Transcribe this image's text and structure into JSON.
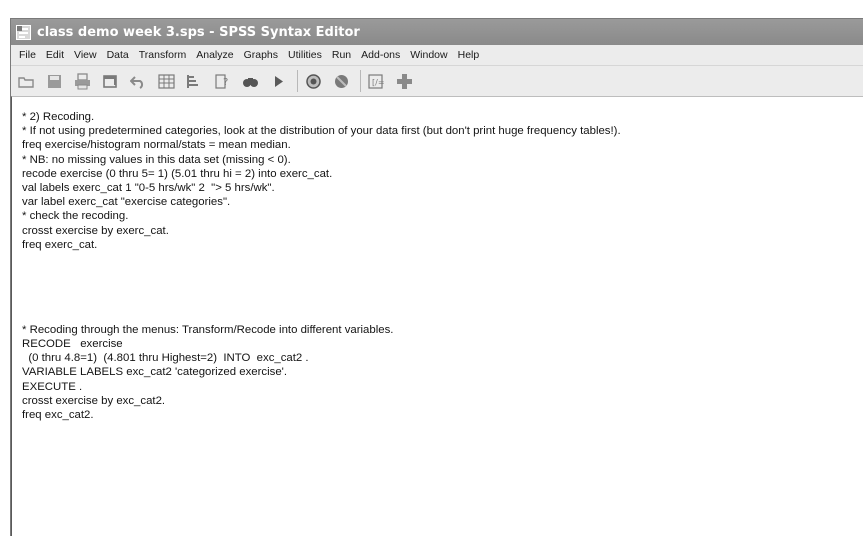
{
  "window": {
    "title": "class demo week 3.sps - SPSS Syntax Editor",
    "icon": "spss-syntax-icon"
  },
  "menu": [
    {
      "label": "File"
    },
    {
      "label": "Edit"
    },
    {
      "label": "View"
    },
    {
      "label": "Data"
    },
    {
      "label": "Transform"
    },
    {
      "label": "Analyze"
    },
    {
      "label": "Graphs"
    },
    {
      "label": "Utilities"
    },
    {
      "label": "Run"
    },
    {
      "label": "Add-ons"
    },
    {
      "label": "Window"
    },
    {
      "label": "Help"
    }
  ],
  "toolbar": [
    {
      "icon": "open-folder-icon"
    },
    {
      "icon": "save-icon"
    },
    {
      "icon": "print-icon"
    },
    {
      "icon": "dialog-recall-icon"
    },
    {
      "icon": "undo-icon"
    },
    {
      "icon": "data-view-icon"
    },
    {
      "icon": "variables-icon"
    },
    {
      "icon": "syntax-help-icon"
    },
    {
      "icon": "find-icon"
    },
    {
      "icon": "run-icon"
    },
    {
      "icon": "use-sets-icon"
    },
    {
      "icon": "show-all-icon"
    },
    {
      "icon": "split-file-icon"
    },
    {
      "icon": "insert-case-icon"
    }
  ],
  "editor": {
    "lines": [
      "* 2) Recoding.",
      "* If not using predetermined categories, look at the distribution of your data first (but don't print huge frequency tables!).",
      "freq exercise/histogram normal/stats = mean median.",
      "* NB: no missing values in this data set (missing < 0).",
      "recode exercise (0 thru 5= 1) (5.01 thru hi = 2) into exerc_cat.",
      "val labels exerc_cat 1 \"0-5 hrs/wk\" 2  \"> 5 hrs/wk\".",
      "var label exerc_cat \"exercise categories\".",
      "* check the recoding.",
      "crosst exercise by exerc_cat.",
      "freq exerc_cat.",
      "",
      "",
      "",
      "",
      "",
      "* Recoding through the menus: Transform/Recode into different variables.",
      "RECODE   exercise",
      "  (0 thru 4.8=1)  (4.801 thru Highest=2)  INTO  exc_cat2 .",
      "VARIABLE LABELS exc_cat2 'categorized exercise'.",
      "EXECUTE .",
      "crosst exercise by exc_cat2.",
      "freq exc_cat2."
    ]
  }
}
